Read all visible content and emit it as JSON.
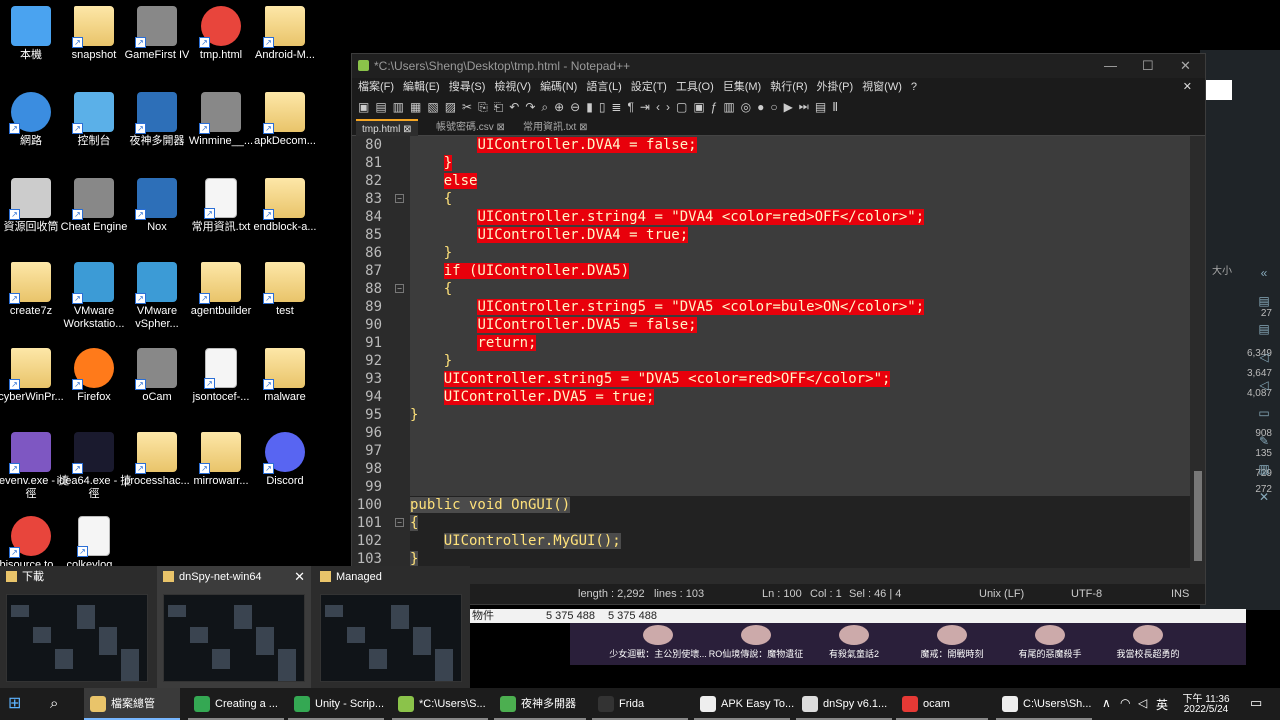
{
  "desktop_icons": [
    {
      "label": "本機",
      "type": "pc"
    },
    {
      "label": "snapshot",
      "type": "folder"
    },
    {
      "label": "GameFirst IV",
      "type": "app"
    },
    {
      "label": "tmp.html",
      "type": "chrome"
    },
    {
      "label": "Android-M...",
      "type": "folder"
    },
    {
      "label": "網路",
      "type": "net"
    },
    {
      "label": "控制台",
      "type": "cp"
    },
    {
      "label": "夜神多開器",
      "type": "nox"
    },
    {
      "label": "Winmine__...",
      "type": "app"
    },
    {
      "label": "apkDecom...",
      "type": "folder"
    },
    {
      "label": "資源回收筒",
      "type": "bin"
    },
    {
      "label": "Cheat Engine",
      "type": "app"
    },
    {
      "label": "Nox",
      "type": "nox"
    },
    {
      "label": "常用資訊.txt",
      "type": "doc"
    },
    {
      "label": "endblock-a...",
      "type": "folder"
    },
    {
      "label": "create7z",
      "type": "folder"
    },
    {
      "label": "VMware Workstatio...",
      "type": "vm"
    },
    {
      "label": "VMware vSpher...",
      "type": "vm"
    },
    {
      "label": "agentbuilder",
      "type": "folder"
    },
    {
      "label": "test",
      "type": "folder"
    },
    {
      "label": "cyberWinPr...",
      "type": "folder"
    },
    {
      "label": "Firefox",
      "type": "firefox"
    },
    {
      "label": "oCam",
      "type": "app"
    },
    {
      "label": "jsontocef-...",
      "type": "doc"
    },
    {
      "label": "malware",
      "type": "folder"
    },
    {
      "label": "devenv.exe - 捷徑",
      "type": "vs"
    },
    {
      "label": "idea64.exe - 捷徑",
      "type": "ij"
    },
    {
      "label": "processhac...",
      "type": "folder"
    },
    {
      "label": "mirrowarr...",
      "type": "folder"
    },
    {
      "label": "Discord",
      "type": "discord"
    },
    {
      "label": "bisource.to...",
      "type": "chrome"
    },
    {
      "label": "colkeylog...",
      "type": "doc"
    }
  ],
  "npp": {
    "title": "*C:\\Users\\Sheng\\Desktop\\tmp.html - Notepad++",
    "menu": [
      "檔案(F)",
      "編輯(E)",
      "搜尋(S)",
      "檢視(V)",
      "編碼(N)",
      "語言(L)",
      "設定(T)",
      "工具(O)",
      "巨集(M)",
      "執行(R)",
      "外掛(P)",
      "視窗(W)",
      "?"
    ],
    "tabs": [
      "tmp.html",
      "帳號密碼.csv",
      "常用資訊.txt"
    ],
    "lines": [
      {
        "n": "80",
        "indent": "        ",
        "text": "UIController.DVA4 = false;",
        "style": "red"
      },
      {
        "n": "81",
        "indent": "    ",
        "text": "}",
        "style": "red"
      },
      {
        "n": "82",
        "indent": "    ",
        "text": "else",
        "style": "red"
      },
      {
        "n": "83",
        "indent": "    ",
        "text": "{",
        "style": "plain"
      },
      {
        "n": "84",
        "indent": "        ",
        "text": "UIController.string4 = \"DVA4 <color=red>OFF</color>\";",
        "style": "red"
      },
      {
        "n": "85",
        "indent": "        ",
        "text": "UIController.DVA4 = true;",
        "style": "red"
      },
      {
        "n": "86",
        "indent": "    ",
        "text": "}",
        "style": "plain"
      },
      {
        "n": "87",
        "indent": "    ",
        "text": "if (UIController.DVA5)",
        "style": "red"
      },
      {
        "n": "88",
        "indent": "    ",
        "text": "{",
        "style": "plain"
      },
      {
        "n": "89",
        "indent": "        ",
        "text": "UIController.string5 = \"DVA5 <color=bule>ON</color>\";",
        "style": "red"
      },
      {
        "n": "90",
        "indent": "        ",
        "text": "UIController.DVA5 = false;",
        "style": "red"
      },
      {
        "n": "91",
        "indent": "        ",
        "text": "return;",
        "style": "red"
      },
      {
        "n": "92",
        "indent": "    ",
        "text": "}",
        "style": "plain"
      },
      {
        "n": "93",
        "indent": "    ",
        "text": "UIController.string5 = \"DVA5 <color=red>OFF</color>\";",
        "style": "red"
      },
      {
        "n": "94",
        "indent": "    ",
        "text": "UIController.DVA5 = true;",
        "style": "red"
      },
      {
        "n": "95",
        "indent": "",
        "text": "}",
        "style": "plain"
      },
      {
        "n": "96",
        "indent": "",
        "text": "",
        "style": "plain"
      },
      {
        "n": "97",
        "indent": "",
        "text": "",
        "style": "plain"
      },
      {
        "n": "98",
        "indent": "",
        "text": "",
        "style": "plain"
      },
      {
        "n": "99",
        "indent": "",
        "text": "",
        "style": "plain"
      },
      {
        "n": "100",
        "indent": "",
        "text": "public void OnGUI()",
        "style": "sel"
      },
      {
        "n": "101",
        "indent": "",
        "text": "{",
        "style": "sel"
      },
      {
        "n": "102",
        "indent": "    ",
        "text": "UIController.MyGUI();",
        "style": "sel"
      },
      {
        "n": "103",
        "indent": "",
        "text": "}",
        "style": "sel"
      }
    ],
    "status": {
      "length": "length : 2,292",
      "lines": "lines : 103",
      "ln": "Ln : 100",
      "col": "Col : 1",
      "sel": "Sel : 46 | 4",
      "eol": "Unix (LF)",
      "enc": "UTF-8",
      "mode": "INS"
    }
  },
  "strip": {
    "label": "物件",
    "v1": "5 375 488",
    "v2": "5 375 488"
  },
  "bg_panel": {
    "header": "大小",
    "values": [
      "27",
      "6,349",
      "3,647",
      "4,087",
      "908",
      "135",
      "729",
      "272"
    ]
  },
  "games": [
    "少女迴戰：主公別使壞...",
    "RO仙境傳說：魔物遺征",
    "有殺氣童話2",
    "魔戒：開戰時刻",
    "有尾的惡魔殺手",
    "我當校長超勇的"
  ],
  "thumbs": [
    {
      "label": "下載"
    },
    {
      "label": "dnSpy-net-win64"
    },
    {
      "label": "Managed"
    }
  ],
  "taskbar": {
    "items": [
      {
        "label": "檔案總管",
        "color": "#e9c46a"
      },
      {
        "label": "Creating a ...",
        "color": "#34a853"
      },
      {
        "label": "Unity - Scrip...",
        "color": "#34a853"
      },
      {
        "label": "*C:\\Users\\S...",
        "color": "#8bc34a"
      },
      {
        "label": "夜神多開器",
        "color": "#4caf50"
      },
      {
        "label": "Frida",
        "color": "#333"
      },
      {
        "label": "APK Easy To...",
        "color": "#eee"
      },
      {
        "label": "dnSpy v6.1...",
        "color": "#ddd"
      },
      {
        "label": "ocam",
        "color": "#e53935"
      },
      {
        "label": "C:\\Users\\Sh...",
        "color": "#eee"
      }
    ],
    "ime": "英",
    "time": "下午 11:36",
    "date": "2022/5/24"
  }
}
